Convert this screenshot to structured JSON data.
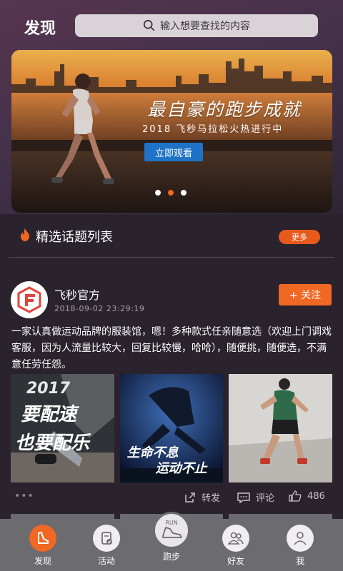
{
  "header": {
    "title": "发现",
    "search_placeholder": "输入想要查找的内容"
  },
  "banner": {
    "headline": "最自豪的跑步成就",
    "subtitle": "2018 飞秒马拉松火热进行中",
    "button_label": "立即观看",
    "dots": 3,
    "active_dot": 2
  },
  "topics": {
    "title": "精选话题列表",
    "more_label": "更多"
  },
  "post": {
    "author": "飞秒官方",
    "time": "2018-09-02  23:29:19",
    "follow_label": "+ 关注",
    "text": "一家认真做运动品牌的服装馆，嗯！多种款式任亲随意选（欢迎上门调戏客服，因为人流量比较大，回复比较慢，哈哈），随便挑，随便选，不满意任劳任怨。",
    "images": [
      {
        "caption_1": "2017",
        "caption_2": "要配速",
        "caption_3": "也要配乐"
      },
      {
        "caption_1": "生命不息",
        "caption_2": "运动不止"
      },
      {
        "caption_1": ""
      }
    ],
    "more": "•••",
    "share_label": "转发",
    "comment_label": "评论",
    "like_count": "486"
  },
  "tabbar": {
    "items": [
      {
        "label": "发现",
        "active": true
      },
      {
        "label": "活动",
        "active": false
      },
      {
        "label": "跑步",
        "active": false,
        "badge": "RUN"
      },
      {
        "label": "好友",
        "active": false
      },
      {
        "label": "我",
        "active": false
      }
    ]
  },
  "colors": {
    "accent": "#f06823",
    "banner_button": "#1f73c7",
    "tabbar": "#6c6b70"
  }
}
